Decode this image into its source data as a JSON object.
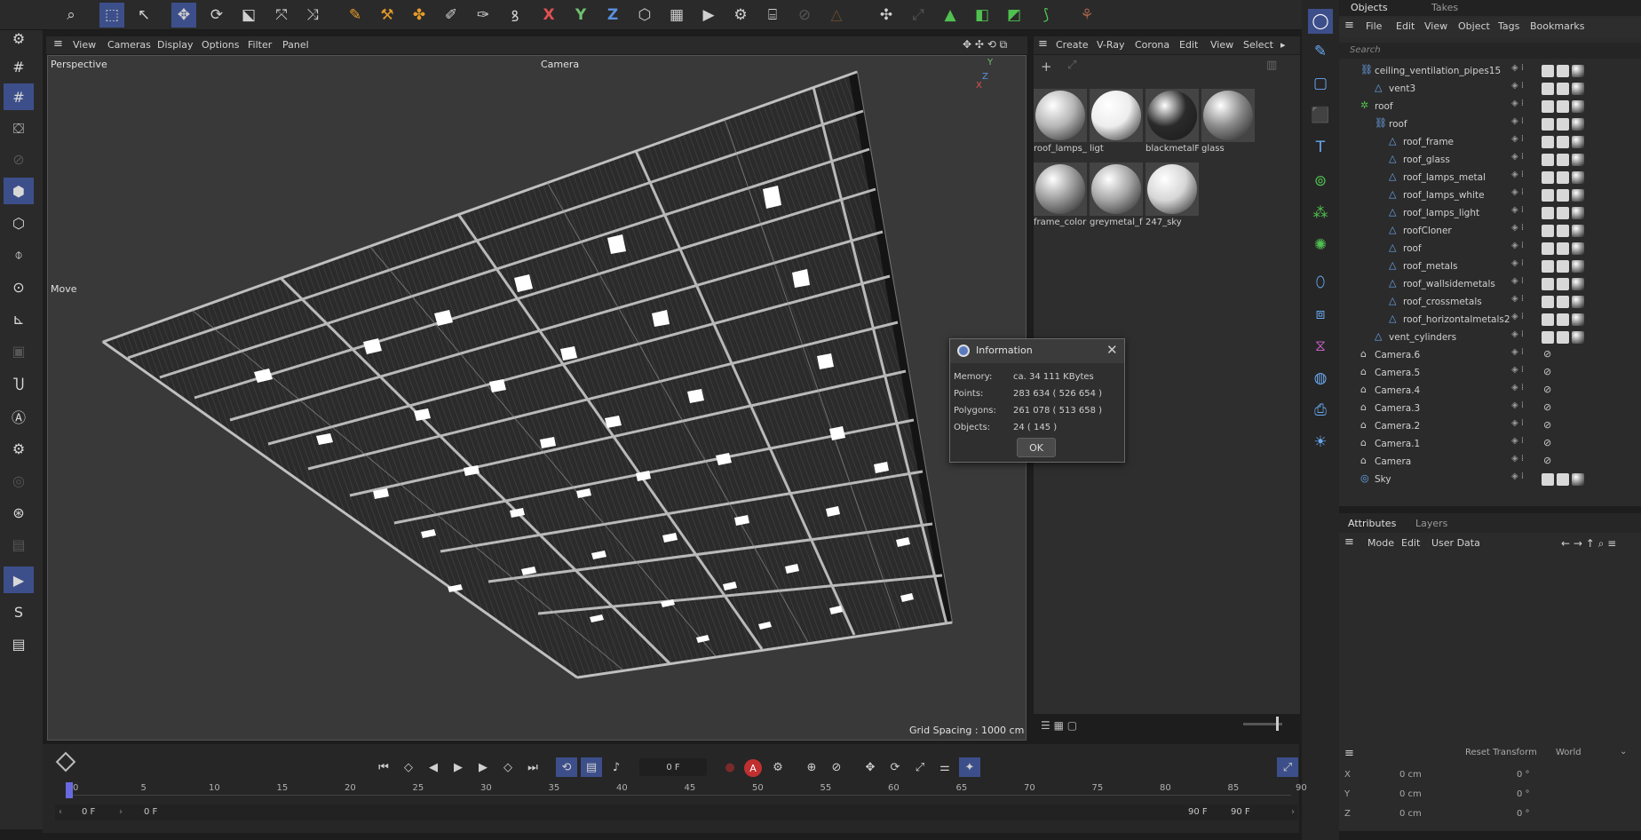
{
  "viewport": {
    "menu": [
      "View",
      "Cameras",
      "Display",
      "Options",
      "Filter",
      "Panel"
    ],
    "label_perspective": "Perspective",
    "label_camera": "Camera",
    "label_move": "Move",
    "grid_spacing": "Grid Spacing : 1000 cm",
    "axis_y": "Y",
    "axis_x": "X",
    "axis_z": "Z"
  },
  "materials": {
    "menu": [
      "Create",
      "V-Ray",
      "Corona",
      "Edit",
      "View",
      "Select"
    ],
    "items": [
      {
        "label": "roof_lamps_",
        "color": "#b5b5b5"
      },
      {
        "label": "ligt",
        "color": "#ededed"
      },
      {
        "label": "blackmetalF",
        "color": "#2a2a2a"
      },
      {
        "label": "glass",
        "color": "#8a8a8a"
      },
      {
        "label": "frame_color",
        "color": "#9a9a9a"
      },
      {
        "label": "greymetal_f",
        "color": "#a6a6a6"
      },
      {
        "label": "247_sky",
        "color": "#d6d6d6"
      }
    ]
  },
  "objects": {
    "tab_objects": "Objects",
    "tab_takes": "Takes",
    "menu": [
      "File",
      "Edit",
      "View",
      "Object",
      "Tags",
      "Bookmarks"
    ],
    "search_placeholder": "Search",
    "rows": [
      {
        "name": "ceiling_ventilation_pipes15",
        "indent": 0,
        "icon": "⛓"
      },
      {
        "name": "vent3",
        "indent": 1,
        "icon": "△"
      },
      {
        "name": "roof",
        "indent": 0,
        "icon": "✲"
      },
      {
        "name": "roof",
        "indent": 1,
        "icon": "⛓"
      },
      {
        "name": "roof_frame",
        "indent": 2,
        "icon": "△"
      },
      {
        "name": "roof_glass",
        "indent": 2,
        "icon": "△"
      },
      {
        "name": "roof_lamps_metal",
        "indent": 2,
        "icon": "△"
      },
      {
        "name": "roof_lamps_white",
        "indent": 2,
        "icon": "△"
      },
      {
        "name": "roof_lamps_light",
        "indent": 2,
        "icon": "△"
      },
      {
        "name": "roofCloner",
        "indent": 2,
        "icon": "△"
      },
      {
        "name": "roof",
        "indent": 2,
        "icon": "△"
      },
      {
        "name": "roof_metals",
        "indent": 2,
        "icon": "△"
      },
      {
        "name": "roof_wallsidemetals",
        "indent": 2,
        "icon": "△"
      },
      {
        "name": "roof_crossmetals",
        "indent": 2,
        "icon": "△"
      },
      {
        "name": "roof_horizontalmetals2",
        "indent": 2,
        "icon": "△"
      },
      {
        "name": "vent_cylinders",
        "indent": 1,
        "icon": "△"
      },
      {
        "name": "Camera.6",
        "indent": 0,
        "icon": "⌂"
      },
      {
        "name": "Camera.5",
        "indent": 0,
        "icon": "⌂"
      },
      {
        "name": "Camera.4",
        "indent": 0,
        "icon": "⌂"
      },
      {
        "name": "Camera.3",
        "indent": 0,
        "icon": "⌂"
      },
      {
        "name": "Camera.2",
        "indent": 0,
        "icon": "⌂"
      },
      {
        "name": "Camera.1",
        "indent": 0,
        "icon": "⌂"
      },
      {
        "name": "Camera",
        "indent": 0,
        "icon": "⌂"
      },
      {
        "name": "Sky",
        "indent": 0,
        "icon": "◎"
      }
    ]
  },
  "attributes": {
    "tab_attributes": "Attributes",
    "tab_layers": "Layers",
    "menu": [
      "Mode",
      "Edit",
      "User Data"
    ],
    "reset_transform": "Reset Transform",
    "world": "World",
    "rows": [
      {
        "axis": "X",
        "pos": "0 cm",
        "rot": "0 °"
      },
      {
        "axis": "Y",
        "pos": "0 cm",
        "rot": "0 °"
      },
      {
        "axis": "Z",
        "pos": "0 cm",
        "rot": "0 °"
      }
    ]
  },
  "timeline": {
    "current_frame": "0 F",
    "ticks": [
      "0",
      "5",
      "10",
      "15",
      "20",
      "25",
      "30",
      "35",
      "40",
      "45",
      "50",
      "55",
      "60",
      "65",
      "70",
      "75",
      "80",
      "85",
      "90"
    ],
    "range_start": "0 F",
    "range_start2": "0 F",
    "range_end": "90 F",
    "range_end2": "90 F"
  },
  "dialog": {
    "title": "Information",
    "rows": [
      {
        "label": "Memory:",
        "value": "ca. 34 111 KBytes"
      },
      {
        "label": "Points:",
        "value": "283 634 ( 526 654 )"
      },
      {
        "label": "Polygons:",
        "value": "261 078 ( 513 658 )"
      },
      {
        "label": "Objects:",
        "value": "24 ( 145 )"
      }
    ],
    "ok": "OK"
  },
  "colors": {
    "accent": "#3d4f8a",
    "panel": "#2b2b2b",
    "viewport": "#393939"
  }
}
